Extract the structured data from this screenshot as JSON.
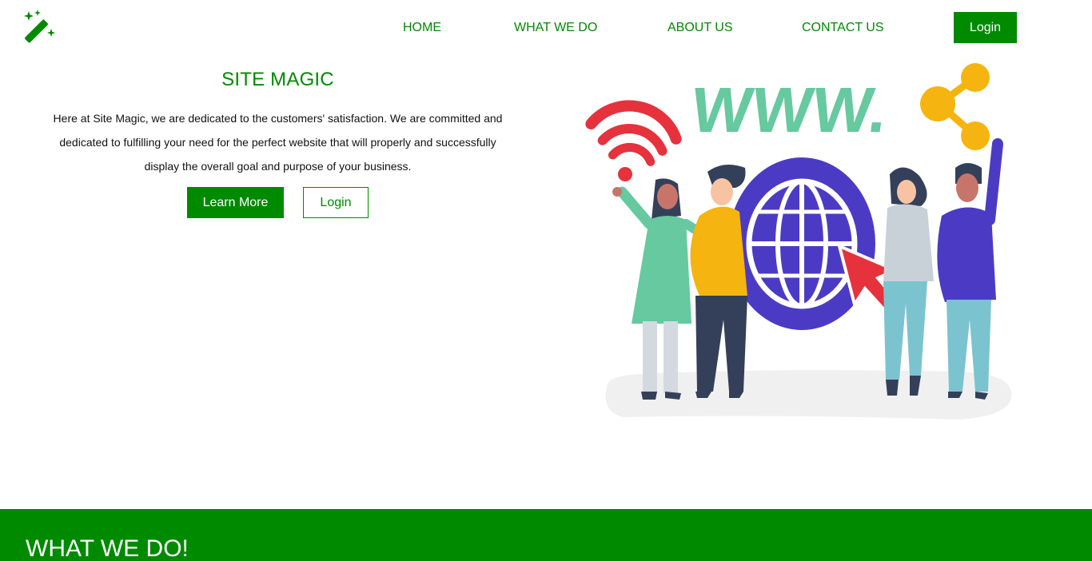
{
  "brand": {
    "logo_icon": "magic-wand-icon",
    "color": "#008a00"
  },
  "nav": {
    "home": "HOME",
    "what_we_do": "WHAT WE DO",
    "about_us": "ABOUT US",
    "contact_us": "CONTACT US",
    "login": "Login"
  },
  "hero": {
    "title": "SITE MAGIC",
    "text": "Here at Site Magic, we are dedicated to the customers' satisfaction. We are committed and dedicated to fulfilling your need for the perfect website that will properly and successfully display the overall goal and purpose of your business.",
    "learn_more": "Learn More",
    "login": "Login"
  },
  "illustration": {
    "www_text": "WWW.",
    "colors": {
      "purple": "#4b3bc4",
      "green": "#66c9a0",
      "red": "#e5323d",
      "yellow": "#f5b40f",
      "teal": "#7cc3d0",
      "navy": "#34405a"
    }
  },
  "section": {
    "title": "WHAT WE DO!"
  }
}
